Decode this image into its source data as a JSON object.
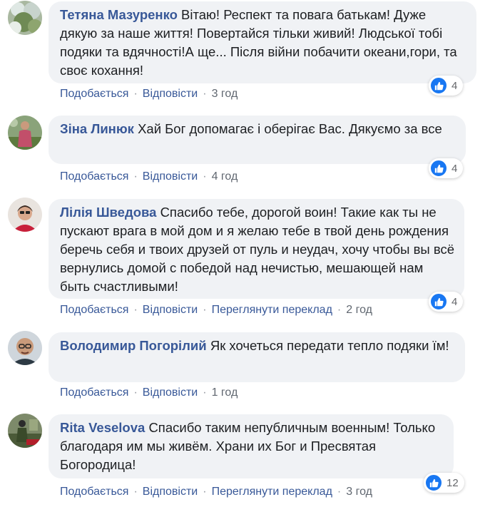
{
  "labels": {
    "like": "Подобається",
    "reply": "Відповісти",
    "translate": "Переглянути переклад"
  },
  "comments": [
    {
      "author": "Тетяна Мазуренко",
      "text": "Вітаю! Респект та повага батькам! Дуже дякую за наше життя! Повертайся тільки живий! Людської тобі подяки та вдячності!А ще... Після війни побачити океани,гори, та своє кохання!",
      "time": "3 год",
      "reactions": "4"
    },
    {
      "author": "Зіна Линюк",
      "text": "Хай Бог допомагає і оберігає Вас. Дякуємо за все",
      "time": "4 год",
      "reactions": "4"
    },
    {
      "author": "Лілія Шведова",
      "text": "Спасибо тебе, дорогой воин! Такие как ты не пускают врага в мой дом и я желаю тебе в твой день рождения беречь себя и твоих друзей от пуль и неудач, хочу чтобы вы всё вернулись домой с победой над нечистью, мешающей нам быть счастливыми!",
      "time": "2 год",
      "reactions": "4"
    },
    {
      "author": "Володимир Погорілий",
      "text": "Як хочеться передати тепло подяки їм!",
      "time": "1 год"
    },
    {
      "author": "Rita Veselova",
      "text": "Спасибо таким непубличным военным! Только благодаря им мы живём. Храни их Бог и Пресвятая Богородица!",
      "time": "3 год",
      "reactions": "12"
    }
  ],
  "colors": {
    "author": "#385898",
    "bubble": "#f0f2f5",
    "like": "#1877f2"
  },
  "icons": {
    "reaction": "like-icon"
  }
}
